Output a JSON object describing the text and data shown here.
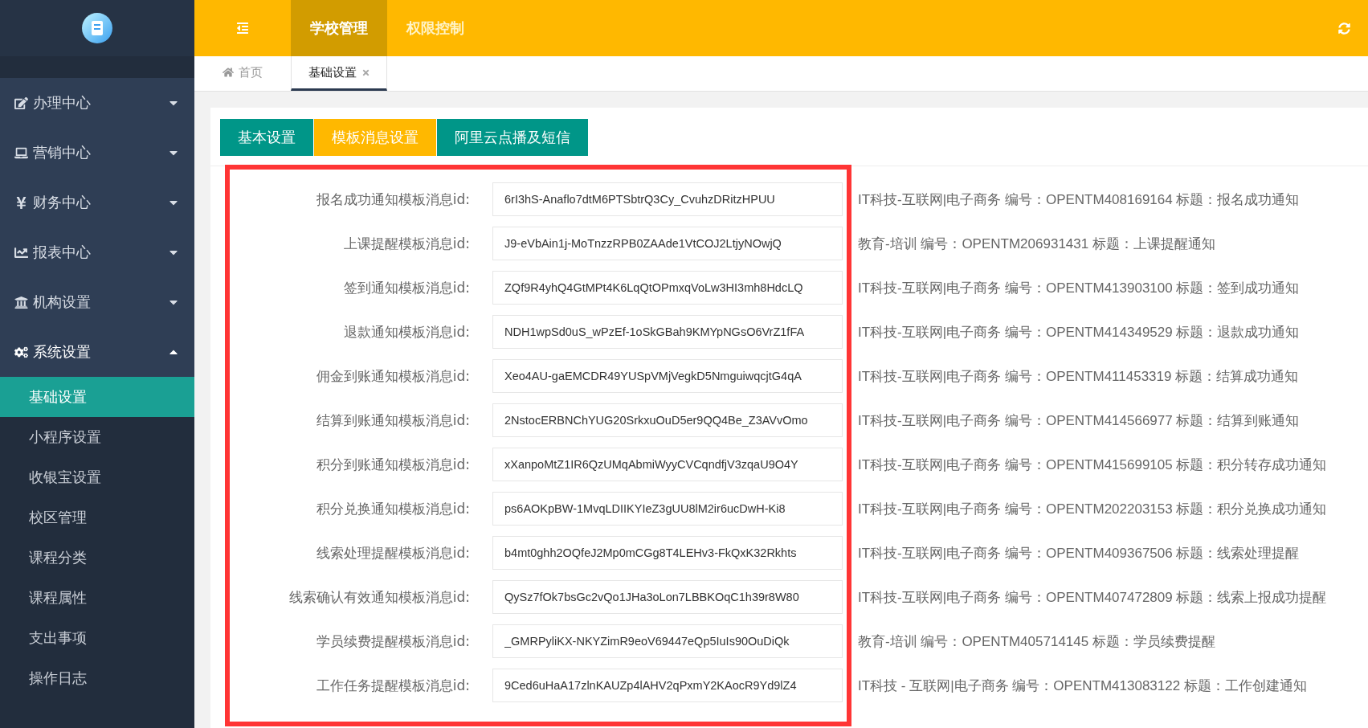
{
  "top_nav": [
    {
      "label": "学校管理",
      "selected": true
    },
    {
      "label": "权限控制",
      "selected": false
    }
  ],
  "sidebar": {
    "menus": [
      {
        "label": "办理中心",
        "expanded": false
      },
      {
        "label": "营销中心",
        "expanded": false
      },
      {
        "label": "财务中心",
        "expanded": false
      },
      {
        "label": "报表中心",
        "expanded": false
      },
      {
        "label": "机构设置",
        "expanded": false
      },
      {
        "label": "系统设置",
        "expanded": true,
        "children": [
          {
            "label": "基础设置",
            "selected": true
          },
          {
            "label": "小程序设置",
            "selected": false
          },
          {
            "label": "收银宝设置",
            "selected": false
          },
          {
            "label": "校区管理",
            "selected": false
          },
          {
            "label": "课程分类",
            "selected": false
          },
          {
            "label": "课程属性",
            "selected": false
          },
          {
            "label": "支出事项",
            "selected": false
          },
          {
            "label": "操作日志",
            "selected": false
          }
        ]
      }
    ]
  },
  "page_tabs": [
    {
      "label": "首页",
      "kind": "home",
      "selected": false
    },
    {
      "label": "基础设置",
      "kind": "closable",
      "selected": true
    }
  ],
  "sub_tabs": [
    {
      "label": "基本设置",
      "selected": false
    },
    {
      "label": "模板消息设置",
      "selected": true
    },
    {
      "label": "阿里云点播及短信",
      "selected": false
    }
  ],
  "rows": [
    {
      "label": "报名成功通知模板消息id:",
      "value": "6rI3hS-Anaflo7dtM6PTSbtrQ3Cy_CvuhzDRitzHPUU",
      "description": "IT科技-互联网|电子商务 编号：OPENTM408169164 标题：报名成功通知"
    },
    {
      "label": "上课提醒模板消息id:",
      "value": "J9-eVbAin1j-MoTnzzRPB0ZAAde1VtCOJ2LtjyNOwjQ",
      "description": "教育-培训 编号：OPENTM206931431 标题：上课提醒通知"
    },
    {
      "label": "签到通知模板消息id:",
      "value": "ZQf9R4yhQ4GtMPt4K6LqQtOPmxqVoLw3HI3mh8HdcLQ",
      "description": "IT科技-互联网|电子商务 编号：OPENTM413903100 标题：签到成功通知"
    },
    {
      "label": "退款通知模板消息id:",
      "value": "NDH1wpSd0uS_wPzEf-1oSkGBah9KMYpNGsO6VrZ1fFA",
      "description": "IT科技-互联网|电子商务 编号：OPENTM414349529 标题：退款成功通知"
    },
    {
      "label": "佣金到账通知模板消息id:",
      "value": "Xeo4AU-gaEMCDR49YUSpVMjVegkD5NmguiwqcjtG4qA",
      "description": "IT科技-互联网|电子商务 编号：OPENTM411453319 标题：结算成功通知"
    },
    {
      "label": "结算到账通知模板消息id:",
      "value": "2NstocERBNChYUG20SrkxuOuD5er9QQ4Be_Z3AVvOmo",
      "description": "IT科技-互联网|电子商务 编号：OPENTM414566977 标题：结算到账通知"
    },
    {
      "label": "积分到账通知模板消息id:",
      "value": "xXanpoMtZ1IR6QzUMqAbmiWyyCVCqndfjV3zqaU9O4Y",
      "description": "IT科技-互联网|电子商务 编号：OPENTM415699105 标题：积分转存成功通知"
    },
    {
      "label": "积分兑换通知模板消息id:",
      "value": "ps6AOKpBW-1MvqLDIIKYIeZ3gUU8lM2ir6ucDwH-Ki8",
      "description": "IT科技-互联网|电子商务 编号：OPENTM202203153 标题：积分兑换成功通知"
    },
    {
      "label": "线索处理提醒模板消息id:",
      "value": "b4mt0ghh2OQfeJ2Mp0mCGg8T4LEHv3-FkQxK32Rkhts",
      "description": "IT科技-互联网|电子商务 编号：OPENTM409367506 标题：线索处理提醒"
    },
    {
      "label": "线索确认有效通知模板消息id:",
      "value": "QySz7fOk7bsGc2vQo1JHa3oLon7LBBKOqC1h39r8W80",
      "description": "IT科技-互联网|电子商务 编号：OPENTM407472809 标题：线索上报成功提醒"
    },
    {
      "label": "学员续费提醒模板消息id:",
      "value": "_GMRPyliKX-NKYZimR9eoV69447eQp5IuIs90OuDiQk",
      "description": "教育-培训 编号：OPENTM405714145 标题：学员续费提醒"
    },
    {
      "label": "工作任务提醒模板消息id:",
      "value": "9Ced6uHaA17zlnKAUZp4lAHV2qPxmY2KAocR9Yd9lZ4",
      "description": "IT科技 - 互联网|电子商务 编号：OPENTM413083122 标题：工作创建通知"
    }
  ]
}
